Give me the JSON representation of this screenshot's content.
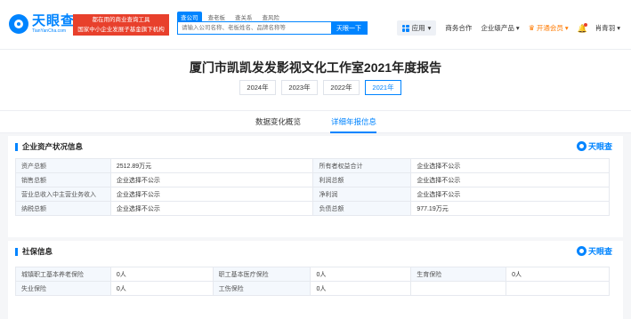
{
  "header": {
    "logo_cn": "天眼查",
    "logo_en": "TianYanCha.com",
    "slogan_line1": "都在用的商业查询工具",
    "slogan_line2": "国家中小企业发展子基金旗下机构",
    "search_tabs": [
      "查公司",
      "查老板",
      "查关系",
      "查风险"
    ],
    "search_placeholder": "请输入公司名称、老板姓名、品牌名称等",
    "search_button": "天眼一下",
    "nav": {
      "app": "应用",
      "biz": "商务合作",
      "enterprise": "企业级产品",
      "vip": "开通会员",
      "user": "肖青羽"
    }
  },
  "report": {
    "title": "厦门市凯凯发发影视文化工作室2021年度报告",
    "years": [
      "2024年",
      "2023年",
      "2022年",
      "2021年"
    ],
    "active_year_index": 3
  },
  "tabs": [
    "数据变化概览",
    "详细年报信息"
  ],
  "active_tab_index": 1,
  "brand_text": "天眼查",
  "assets": {
    "title": "企业资产状况信息",
    "rows": [
      [
        "资产总额",
        "2512.89万元",
        "所有者权益合计",
        "企业选择不公示"
      ],
      [
        "销售总额",
        "企业选择不公示",
        "利润总额",
        "企业选择不公示"
      ],
      [
        "营业总收入中主营业务收入",
        "企业选择不公示",
        "净利润",
        "企业选择不公示"
      ],
      [
        "纳税总额",
        "企业选择不公示",
        "负债总额",
        "977.19万元"
      ]
    ]
  },
  "social": {
    "title": "社保信息",
    "rows": [
      [
        "城镇职工基本养老保险",
        "0人",
        "职工基本医疗保险",
        "0人",
        "生育保险",
        "0人"
      ],
      [
        "失业保险",
        "0人",
        "工伤保险",
        "0人",
        "",
        ""
      ]
    ]
  },
  "colors": {
    "accent": "#0084ff",
    "slogan_bg": "#e8402c",
    "vip": "#ff7a00"
  }
}
